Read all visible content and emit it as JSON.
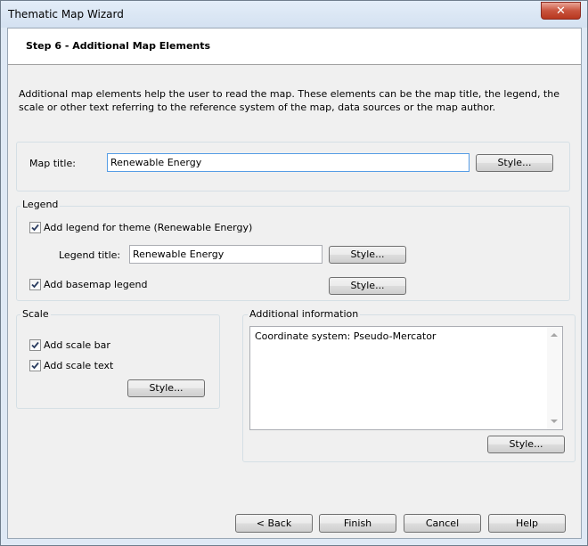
{
  "window": {
    "title": "Thematic Map Wizard",
    "close_glyph": "✕"
  },
  "header": {
    "step_title": "Step 6 - Additional Map Elements"
  },
  "description": "Additional map elements help the user to read the map. These elements can be the map title, the legend, the scale or other text referring to the reference system of the map, data sources or the map author.",
  "map_title": {
    "label": "Map title:",
    "value": "Renewable Energy",
    "style_button": "Style..."
  },
  "legend": {
    "group_label": "Legend",
    "add_legend": {
      "label": "Add legend for theme (Renewable Energy)",
      "checked": true
    },
    "legend_title_label": "Legend title:",
    "legend_title_value": "Renewable Energy",
    "style_button": "Style...",
    "add_basemap": {
      "label": "Add basemap legend",
      "checked": true
    },
    "basemap_style_button": "Style..."
  },
  "scale": {
    "group_label": "Scale",
    "add_scale_bar": {
      "label": "Add scale bar",
      "checked": true
    },
    "add_scale_text": {
      "label": "Add scale text",
      "checked": true
    },
    "style_button": "Style..."
  },
  "additional_info": {
    "group_label": "Additional information",
    "text": "Coordinate system: Pseudo-Mercator",
    "style_button": "Style..."
  },
  "footer": {
    "back": "< Back",
    "finish": "Finish",
    "cancel": "Cancel",
    "help": "Help"
  }
}
